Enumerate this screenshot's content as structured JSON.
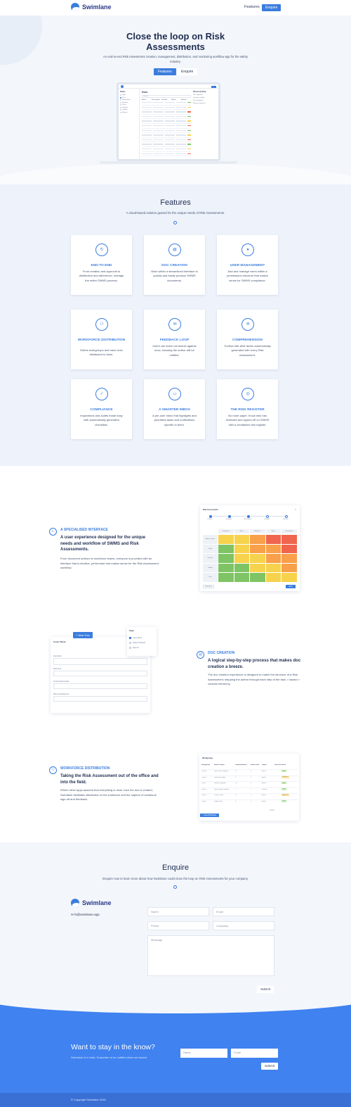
{
  "brand": {
    "name": "Swimlane",
    "accent": "#3b7ddd"
  },
  "nav": {
    "features": "Features",
    "enquire": "Enquire"
  },
  "hero": {
    "title": "Close the loop on Risk Assessments",
    "subtitle": "An end-to-end Risk Assessment creation, management, distribution, and monitoring workflow app for the safety industry.",
    "btn_features": "Features",
    "btn_enquire": "Enquire",
    "app": {
      "header": "Swms",
      "title": "Docs",
      "search": "Search",
      "side_items": [
        "Inbox",
        "Docs",
        "Workgroups",
        "Register",
        "Users",
        "Settings",
        "Toolbox",
        "Reports"
      ],
      "columns": [
        "Name",
        "Description",
        "Created",
        "Status",
        "Actions"
      ],
      "panel_title": "Recent Activity",
      "panel_lines": [
        "Doc approved",
        "Comment added",
        "Doc distributed",
        "Review requested"
      ]
    }
  },
  "features": {
    "title": "Features",
    "subtitle": "A cloud-based solution geared for the unique needs of Risk Assessments.",
    "cards": [
      {
        "icon": "refresh-icon",
        "glyph": "↻",
        "title": "END-TO-END",
        "text": "From creation and approval to distribution and adherence, manage the entire SWMS process."
      },
      {
        "icon": "document-icon",
        "glyph": "▤",
        "title": "DOC CREATION",
        "text": "Work within a streamlined interface to quickly and easily produce SWMS documents."
      },
      {
        "icon": "user-icon",
        "glyph": "●",
        "title": "USER MANAGEMENT",
        "text": "Add and manage users within a permissions structure that makes sense for SWMS compliance."
      },
      {
        "icon": "group-icon",
        "glyph": "⚇",
        "title": "WORKFORCE DISTRIBUTION",
        "text": "Define workgroups and have docs distributed to them."
      },
      {
        "icon": "comment-icon",
        "glyph": "✉",
        "title": "FEEDBACK LOOP",
        "text": "Users can leave comments against docs, knowing the author will be notified."
      },
      {
        "icon": "compass-icon",
        "glyph": "✣",
        "title": "COMPREHENSION",
        "text": "Toolbox talk slide decks automatically generated with every Risk Assessment."
      },
      {
        "icon": "checklist-icon",
        "glyph": "✓",
        "title": "COMPLIANCE",
        "text": "Inspections and audits made easy with automatically generated checklists."
      },
      {
        "icon": "inbox-icon",
        "glyph": "▭",
        "title": "A SMARTER INBOX",
        "text": "A per-user inbox that highlights and prioritises tasks and notifications specific to them."
      },
      {
        "icon": "register-icon",
        "glyph": "◎",
        "title": "THE RISK REGISTER",
        "text": "No more paper. Know who has reviewed and signed-off on SWMS with a centralised risk register."
      }
    ]
  },
  "details": [
    {
      "icon": "interface-icon",
      "glyph": "◐",
      "label": "A SPECIALISED INTERFACE",
      "heading": "A user experience designed for the unique needs and workflow of SWMS and Risk Assessments.",
      "text": "From document authors to workforce teams, everyone is provided with an interface that is intuitive, performant and makes sense for the Risk Assessment workflow."
    },
    {
      "icon": "doc-creation-icon",
      "glyph": "▤",
      "label": "DOC CREATION",
      "heading": "A logical step-by-step process that makes doc creation a breeze.",
      "text": "The doc creation experience is designed to match the structure of a Risk Assessment; stepping the author through each step of the task > hazard > controls hierarchy."
    },
    {
      "icon": "distribution-icon",
      "glyph": "⚇",
      "label": "WORKFORCE DISTRIBUTION",
      "heading": "Taking the Risk Assessment out of the office and into the field.",
      "text": "Where other apps assume that everything is done once the doc is created, Swimlane facilitates distribution to the workforce and the capture of workforce sign-off and feedback."
    }
  ],
  "risk_shot": {
    "title": "Risk Assessment",
    "steps": [
      "Details",
      "Hazards",
      "Risk Matrix",
      "Controls",
      "Review"
    ],
    "cols": [
      "Insignificant",
      "Minor",
      "Moderate",
      "Major",
      "Catastrophic"
    ],
    "rows": [
      "Almost certain",
      "Likely",
      "Possible",
      "Unlikely",
      "Rare"
    ],
    "btn_prev": "Previous",
    "btn_next": "Next",
    "colors": {
      "red": "#f0654d",
      "orange": "#f9a04a",
      "yellow": "#f7d24d",
      "green": "#7fc464"
    }
  },
  "doc_shot": {
    "new_doc": "+ New Doc",
    "cover": "Cover Sheet",
    "menu_title": "Steps",
    "menu_items": [
      "Cover Sheet",
      "Tasks & Hazards",
      "Sign-off"
    ],
    "fields": [
      "Description",
      "Work Area",
      "Persons Responsible",
      "Plant and Equipment"
    ]
  },
  "wg_shot": {
    "title": "Workgroups",
    "columns": [
      "Workgroup",
      "Active Project",
      "Group Members",
      "Active Docs",
      "Status",
      "Sig. Risk Score"
    ],
    "rows": [
      [
        "Crew A",
        "Main Street Highway",
        "12",
        "4",
        "Active",
        "Low"
      ],
      [
        "Crew B",
        "Riverside Bridge",
        "9",
        "3",
        "Active",
        "Medium"
      ],
      [
        "Crew C",
        "Harbour Upgrade",
        "15",
        "6",
        "Active",
        "Low"
      ],
      [
        "Crew D",
        "North Station Rebuild",
        "7",
        "2",
        "Inactive",
        "Low"
      ],
      [
        "Crew E",
        "Central Tower",
        "11",
        "5",
        "Active",
        "Medium"
      ],
      [
        "Crew F",
        "Ridge Road",
        "8",
        "1",
        "Active",
        "Low"
      ]
    ],
    "add_btn": "+ New Workgroup",
    "pager": "1 of 2"
  },
  "enquire": {
    "title": "Enquire",
    "subtitle": "Enquire now to learn more about how Swimlane could close the loop on Risk Assessments for your company.",
    "email": "hi@swimlane.app",
    "name_ph": "Name",
    "email_ph": "Email",
    "phone_ph": "Phone",
    "company_ph": "Company",
    "message_ph": "Message",
    "submit": "Submit"
  },
  "newsletter": {
    "title": "Want to stay in the know?",
    "subtitle": "Swimlane is in beta. Subscribe to be notified when we launch.",
    "name_ph": "Name",
    "email_ph": "Email",
    "submit": "Submit"
  },
  "footer": {
    "copyright": "© Copyright Swimlane 2018"
  }
}
